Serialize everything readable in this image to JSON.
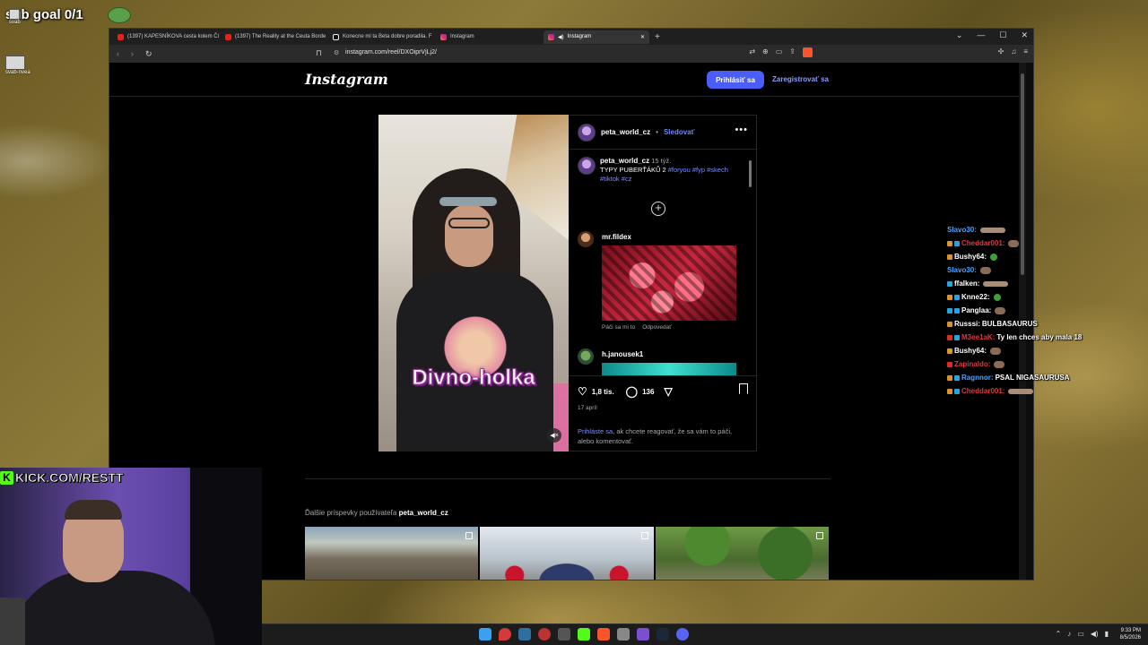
{
  "overlay": {
    "sub_goal": "sub goal 0/1",
    "desktop_icons": [
      "svab",
      "svab-nvea"
    ],
    "kick_channel": "KICK.COM/RESTT"
  },
  "browser": {
    "tabs": [
      {
        "label": "(1397) KAPESNÍKOVA cesta kolem Čí",
        "icon": "youtube-icon"
      },
      {
        "label": "(1397) The Reality at the Ceuta Borde",
        "icon": "youtube-icon"
      },
      {
        "label": "Konecne mi ta Beta dobre poradila. F",
        "icon": "tiktok-icon"
      },
      {
        "label": "Instagram",
        "icon": "instagram-icon"
      },
      {
        "label": "Instagram",
        "icon": "instagram-icon",
        "active": true
      }
    ],
    "url": "instagram.com/reel/DXOiprVjLj2/"
  },
  "instagram": {
    "logo": "Instagram",
    "login_label": "Prihlásiť sa",
    "signup_label": "Zaregistrovať sa",
    "video_caption": "Divno-holka",
    "post": {
      "username": "peta_world_cz",
      "separator": "•",
      "follow_label": "Sledovať",
      "time_ago": "15 týž.",
      "caption_text": "TYPY PUBERŤÁKŮ 2",
      "hashtags": [
        "#foryou",
        "#fyp",
        "#skech",
        "#tiktok",
        "#cz"
      ],
      "likes": "1,8 tis.",
      "comments_count": "136",
      "date": "17 apríl",
      "login_prompt_link": "Prihláste sa",
      "login_prompt_text": ", ak chcete reagovať, že sa vám to páči, alebo komentovať."
    },
    "comments": [
      {
        "username": "mr.fildex",
        "like_label": "Páči sa mi to",
        "reply_label": "Odpovedať"
      },
      {
        "username": "h.janousek1"
      }
    ],
    "more_posts_prefix": "Ďalšie príspevky používateľa",
    "more_posts_user": "peta_world_cz"
  },
  "chat": [
    {
      "name": "Slavo30:",
      "name_color": "#4aa3ff",
      "badges": [],
      "message": ""
    },
    {
      "name": "Cheddar001:",
      "name_color": "#e0383b",
      "badges": [
        "or",
        "bl"
      ],
      "message": ""
    },
    {
      "name": "Bushy64:",
      "name_color": "#ffffff",
      "badges": [
        "or"
      ],
      "message": ""
    },
    {
      "name": "Slavo30:",
      "name_color": "#4aa3ff",
      "badges": [],
      "message": ""
    },
    {
      "name": "ffalken:",
      "name_color": "#ffffff",
      "badges": [
        "bl"
      ],
      "message": ""
    },
    {
      "name": "Knne22:",
      "name_color": "#ffffff",
      "badges": [
        "or",
        "bl"
      ],
      "message": ""
    },
    {
      "name": "Panglaa:",
      "name_color": "#ffffff",
      "badges": [
        "bl",
        "bl"
      ],
      "message": ""
    },
    {
      "name": "Russsi:",
      "name_color": "#ffffff",
      "badges": [
        "or"
      ],
      "message": "BULBASAURUS"
    },
    {
      "name": "M3ee1aK:",
      "name_color": "#e0383b",
      "badges": [
        "rd",
        "bl"
      ],
      "message": "Ty len chces aby mala 18"
    },
    {
      "name": "Bushy64:",
      "name_color": "#ffffff",
      "badges": [
        "or"
      ],
      "message": ""
    },
    {
      "name": "Zapinaldo:",
      "name_color": "#e0383b",
      "badges": [
        "rd"
      ],
      "message": ""
    },
    {
      "name": "Ragnnor:",
      "name_color": "#4aa3ff",
      "badges": [
        "or",
        "bl"
      ],
      "message": "PSAL NIGASAURUSA"
    },
    {
      "name": "Cheddar001:",
      "name_color": "#e0383b",
      "badges": [
        "or",
        "bl"
      ],
      "message": ""
    }
  ],
  "clock": {
    "time": "9:33 PM",
    "date": "8/5/2026"
  }
}
